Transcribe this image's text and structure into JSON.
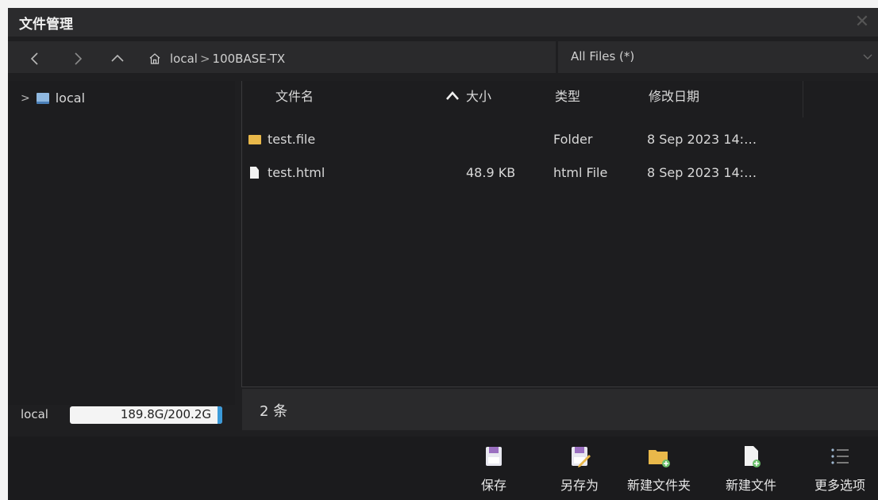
{
  "window": {
    "title": "文件管理",
    "close_glyph": "✕"
  },
  "nav": {
    "breadcrumb": [
      "local",
      "100BASE-TX"
    ],
    "breadcrumb_sep": ">",
    "filter": "All Files (*)"
  },
  "sidebar": {
    "items": [
      {
        "label": "local",
        "icon": "drive-icon",
        "expanded": false
      }
    ]
  },
  "file_list": {
    "columns": [
      "文件名",
      "大小",
      "类型",
      "修改日期"
    ],
    "sort_column": "文件名",
    "sort_direction": "ascending",
    "rows": [
      {
        "name": "test.file",
        "size": "",
        "type": "Folder",
        "modified": "8 Sep 2023 14:…",
        "icon": "folder-icon"
      },
      {
        "name": "test.html",
        "size": "48.9 KB",
        "type": "html File",
        "modified": "8 Sep 2023 14:…",
        "icon": "file-icon"
      }
    ]
  },
  "status": {
    "drive_label": "local",
    "storage": "189.8G/200.2G",
    "item_count": "2 条"
  },
  "toolbar": {
    "save": "保存",
    "save_as": "另存为",
    "new_folder": "新建文件夹",
    "new_file": "新建文件",
    "more_options": "更多选项"
  },
  "colors": {
    "background": "#1f1f21",
    "panel": "#2a2a2c",
    "folder": "#e9b84a",
    "accent": "#3b9ad9"
  }
}
